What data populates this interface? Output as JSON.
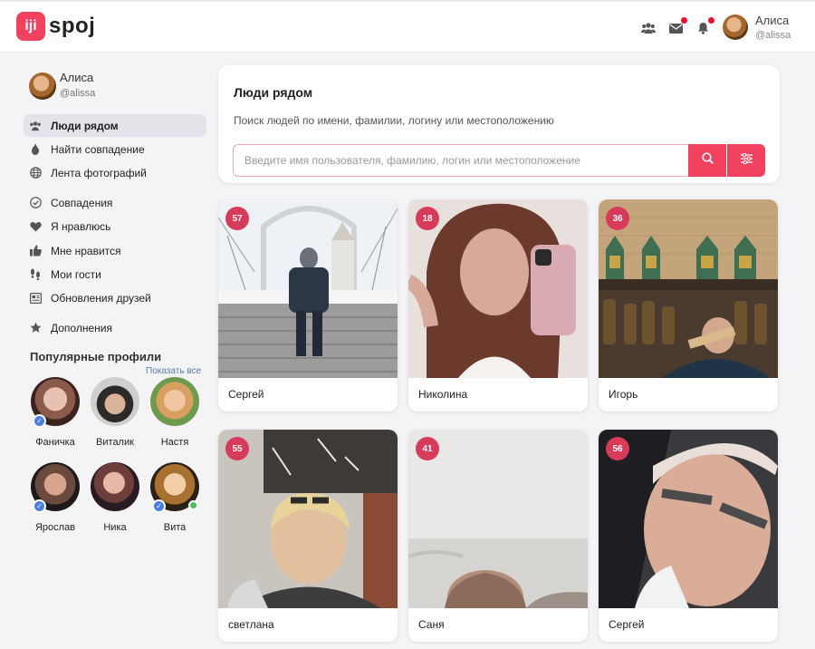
{
  "brand": {
    "mark": "iji",
    "name": "spoj",
    "color": "#f0415f"
  },
  "header": {
    "user_name": "Алиса",
    "user_login": "@alissa",
    "icons": [
      "people-icon",
      "mail-icon",
      "bell-icon"
    ]
  },
  "sidebar": {
    "user_name": "Алиса",
    "user_login": "@alissa",
    "items": [
      {
        "label": "Люди рядом",
        "icon": "people-icon",
        "active": true
      },
      {
        "label": "Найти совпадение",
        "icon": "flame-icon"
      },
      {
        "label": "Лента фотографий",
        "icon": "globe-icon"
      },
      {
        "label": "Совпадения",
        "icon": "check-circle-icon"
      },
      {
        "label": "Я нравлюсь",
        "icon": "heart-icon"
      },
      {
        "label": "Мне нравится",
        "icon": "thumbs-up-icon"
      },
      {
        "label": "Мои гости",
        "icon": "footprints-icon"
      },
      {
        "label": "Обновления друзей",
        "icon": "newspaper-icon"
      },
      {
        "label": "Дополнения",
        "icon": "star-icon"
      }
    ],
    "popular_title": "Популярные профили",
    "show_all": "Показать все",
    "popular": [
      {
        "name": "Фаничка",
        "verified": true
      },
      {
        "name": "Виталик"
      },
      {
        "name": "Настя"
      },
      {
        "name": "Ярослав",
        "verified": true
      },
      {
        "name": "Ника"
      },
      {
        "name": "Вита",
        "verified": true,
        "online": true
      }
    ]
  },
  "search": {
    "title": "Люди рядом",
    "description": "Поиск людей по имени, фамилии, логину или местоположению",
    "placeholder": "Введите имя пользователя, фамилию, логин или местоположение"
  },
  "users": [
    {
      "name": "Сергей",
      "age": "57"
    },
    {
      "name": "Николина",
      "age": "18"
    },
    {
      "name": "Игорь",
      "age": "36"
    },
    {
      "name": "светлана",
      "age": "55"
    },
    {
      "name": "Саня",
      "age": "41"
    },
    {
      "name": "Сергей",
      "age": "56"
    }
  ]
}
